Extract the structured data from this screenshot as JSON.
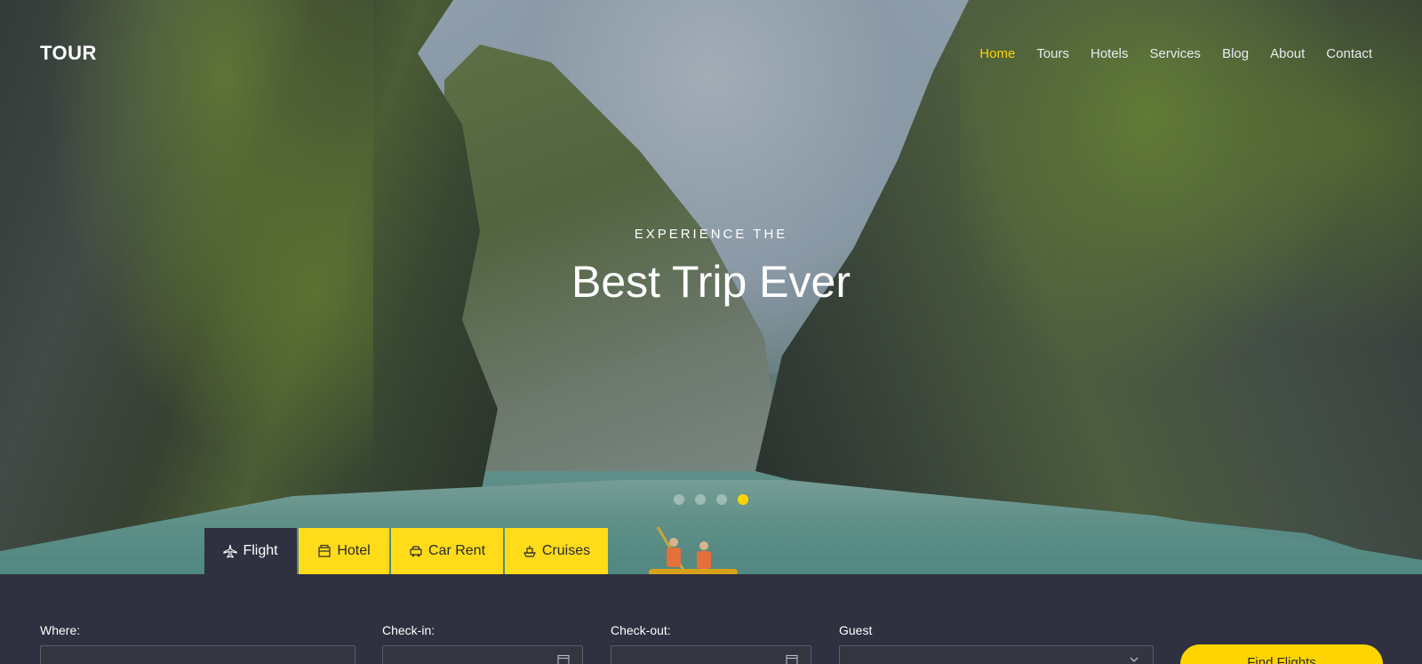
{
  "brand": {
    "logo": "TOUR"
  },
  "nav": {
    "items": [
      {
        "label": "Home",
        "active": true
      },
      {
        "label": "Tours"
      },
      {
        "label": "Hotels"
      },
      {
        "label": "Services"
      },
      {
        "label": "Blog"
      },
      {
        "label": "About"
      },
      {
        "label": "Contact"
      }
    ]
  },
  "hero": {
    "eyebrow": "EXPERIENCE THE",
    "headline": "Best Trip Ever",
    "slide_count": 4,
    "active_slide": 4
  },
  "tabs": [
    {
      "label": "Flight",
      "icon": "plane-icon",
      "active": true
    },
    {
      "label": "Hotel",
      "icon": "hotel-icon"
    },
    {
      "label": "Car Rent",
      "icon": "car-icon"
    },
    {
      "label": "Cruises",
      "icon": "ship-icon"
    }
  ],
  "search": {
    "where_label": "Where:",
    "checkin_label": "Check-in:",
    "checkout_label": "Check-out:",
    "guest_label": "Guest",
    "button_label": "Find Flights"
  },
  "colors": {
    "accent": "#ffd400",
    "panel": "#2f3040"
  }
}
